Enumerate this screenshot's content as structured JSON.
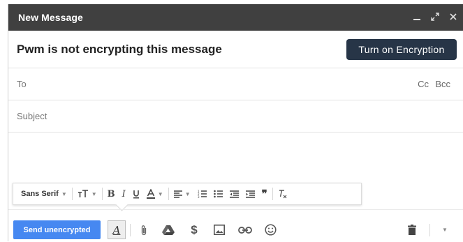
{
  "window": {
    "title": "New Message"
  },
  "encryption": {
    "status_text": "Pwm is not encrypting this message",
    "button_label": "Turn on Encryption"
  },
  "to_field": {
    "label": "To",
    "cc": "Cc",
    "bcc": "Bcc"
  },
  "subject_field": {
    "placeholder": "Subject"
  },
  "formatting": {
    "font": "Sans Serif",
    "icons": [
      "font-size-icon",
      "bold-icon",
      "italic-icon",
      "underline-icon",
      "text-color-icon",
      "align-icon",
      "numbered-list-icon",
      "bulleted-list-icon",
      "indent-less-icon",
      "indent-more-icon",
      "quote-icon",
      "remove-formatting-icon"
    ]
  },
  "toolbar": {
    "send_label": "Send unencrypted",
    "icons": [
      "formatting-options-icon",
      "attach-file-icon",
      "google-drive-icon",
      "send-money-icon",
      "insert-photo-icon",
      "insert-link-icon",
      "emoji-icon",
      "discard-draft-icon",
      "more-options-icon"
    ]
  },
  "colors": {
    "titlebar": "#404040",
    "encrypt_button": "#273547",
    "send_button": "#4688f1"
  }
}
